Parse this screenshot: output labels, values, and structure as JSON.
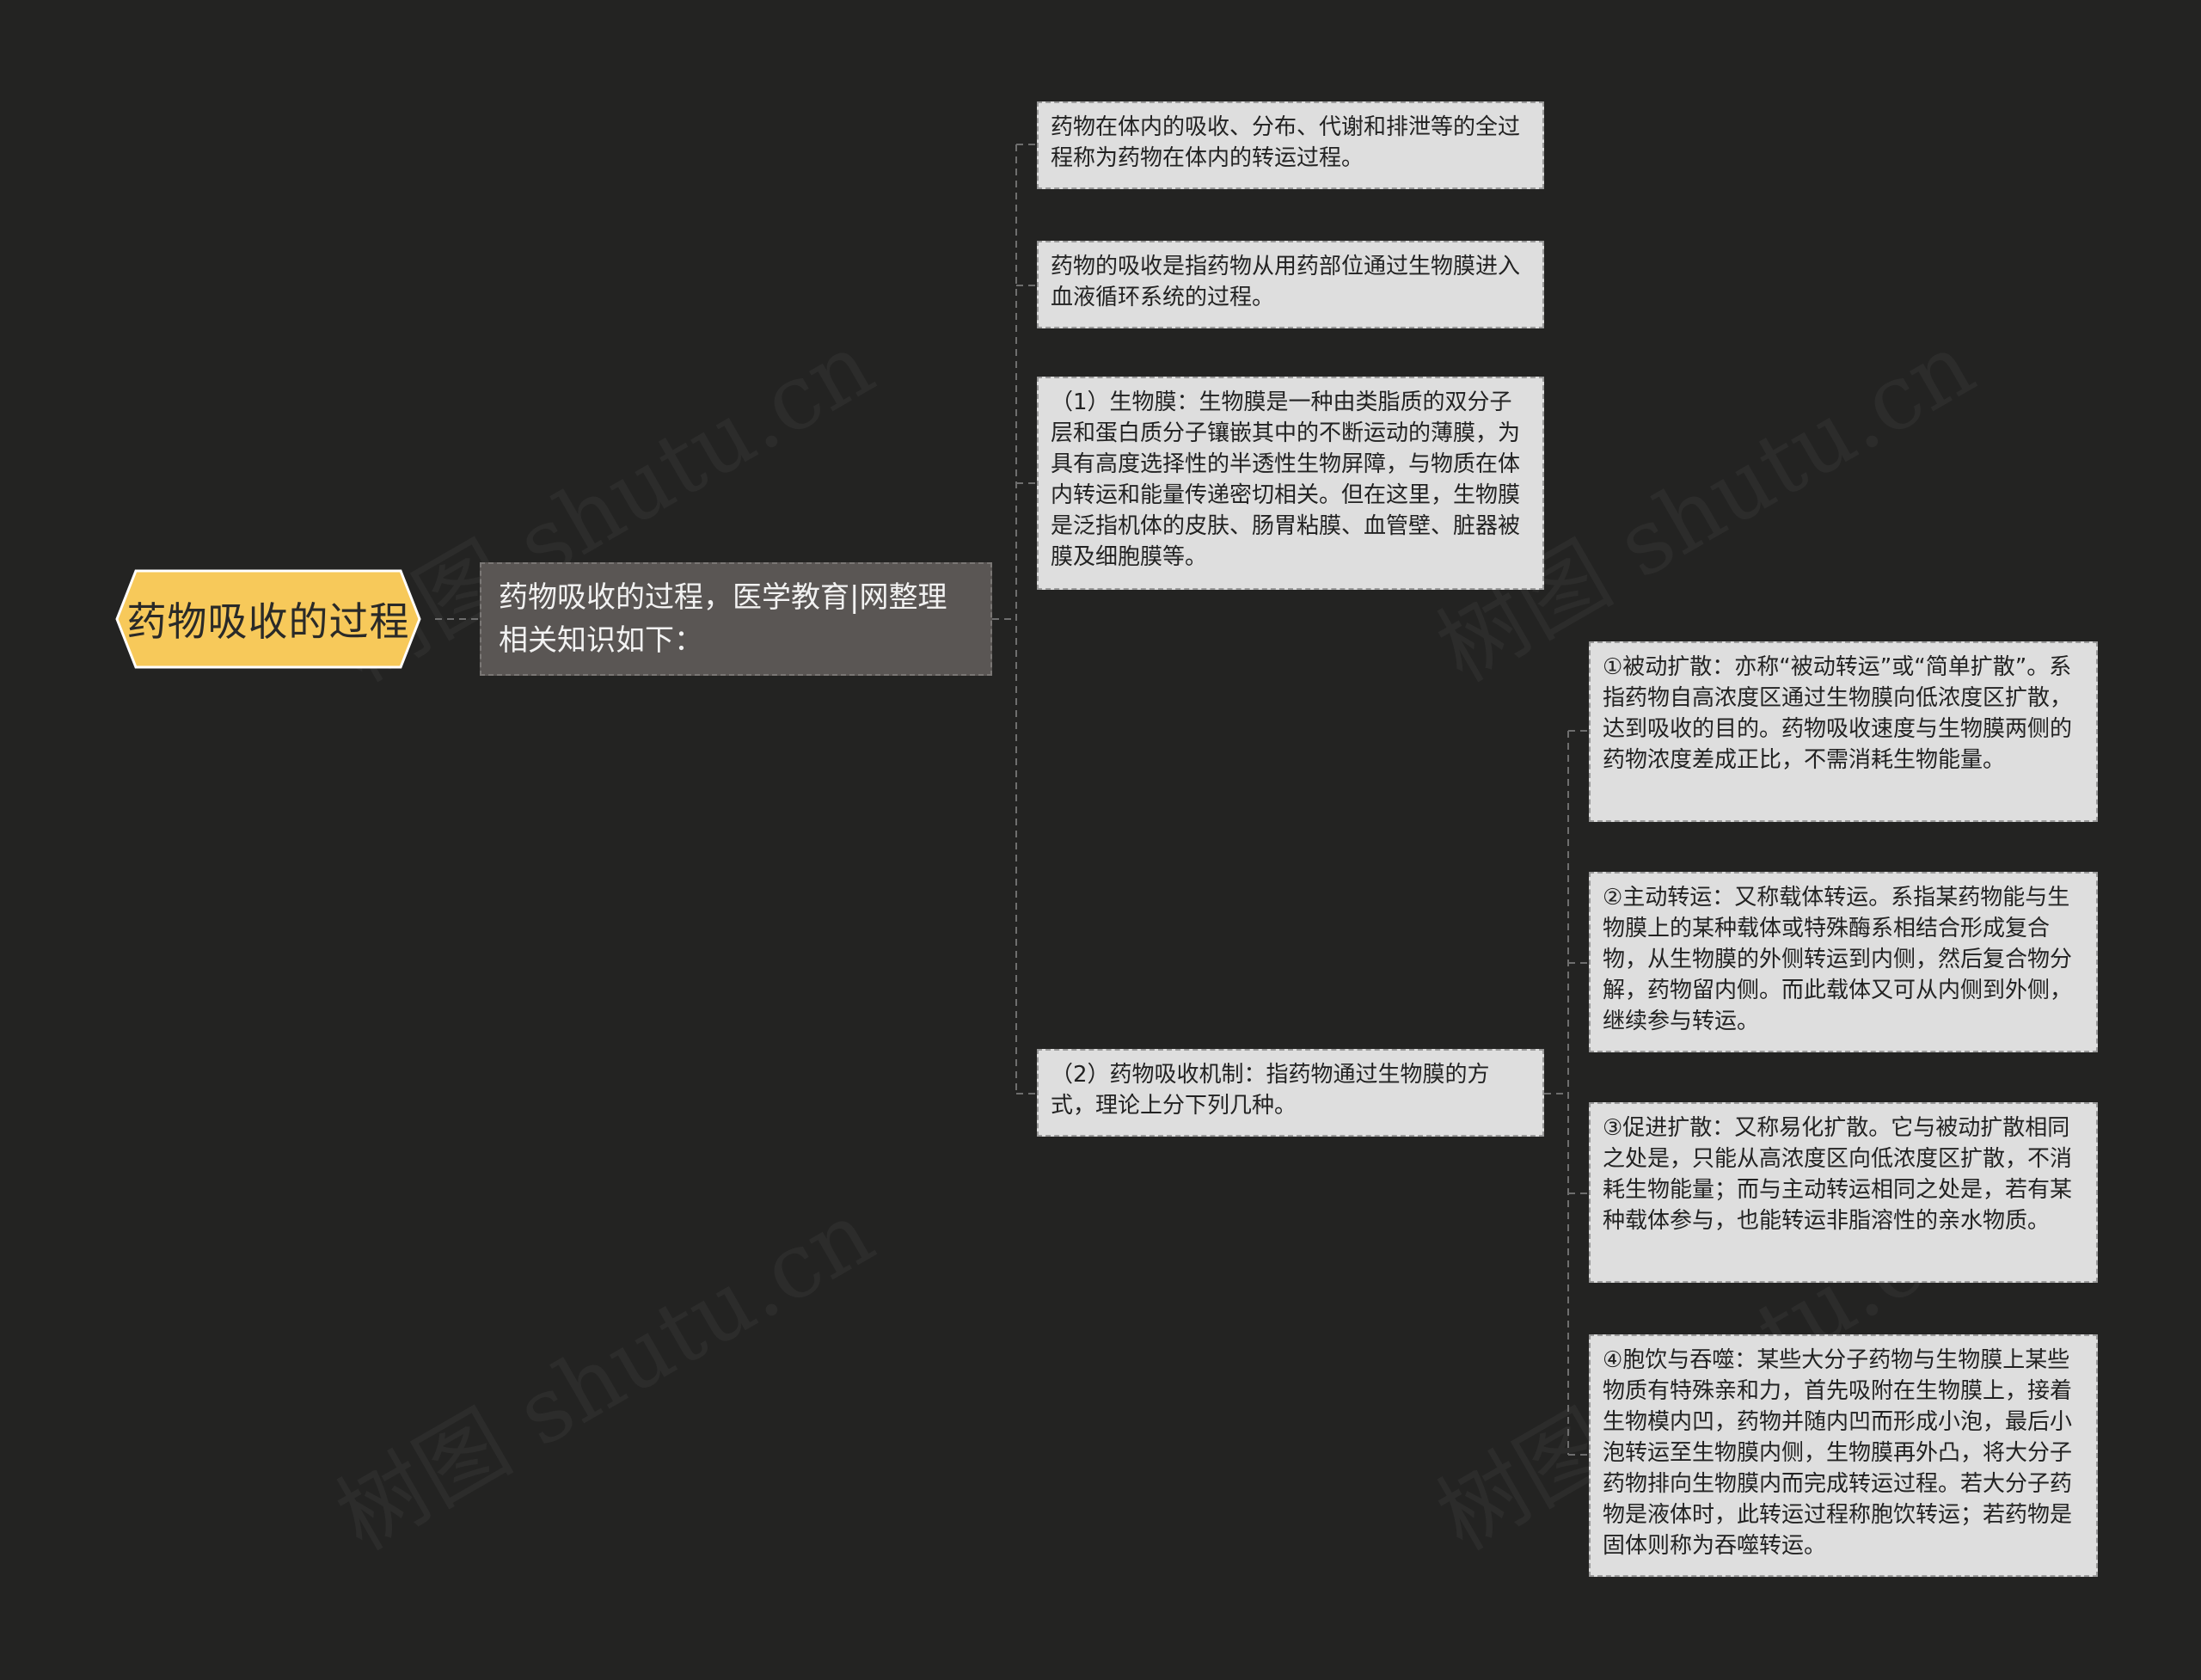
{
  "root": {
    "label": "药物吸收的过程"
  },
  "branch": {
    "label": "药物吸收的过程，医学教育|网整理相关知识如下："
  },
  "children": [
    {
      "text": "药物在体内的吸收、分布、代谢和排泄等的全过程称为药物在体内的转运过程。"
    },
    {
      "text": "药物的吸收是指药物从用药部位通过生物膜进入血液循环系统的过程。"
    },
    {
      "text": "（1）生物膜：生物膜是一种由类脂质的双分子层和蛋白质分子镶嵌其中的不断运动的薄膜，为具有高度选择性的半透性生物屏障，与物质在体内转运和能量传递密切相关。但在这里，生物膜是泛指机体的皮肤、肠胃粘膜、血管壁、脏器被膜及细胞膜等。"
    },
    {
      "text": "（2）药物吸收机制：指药物通过生物膜的方式，理论上分下列几种。"
    }
  ],
  "mechanisms": [
    {
      "text": "①被动扩散：亦称“被动转运”或“简单扩散”。系指药物自高浓度区通过生物膜向低浓度区扩散，达到吸收的目的。药物吸收速度与生物膜两侧的药物浓度差成正比，不需消耗生物能量。"
    },
    {
      "text": "②主动转运：又称载体转运。系指某药物能与生物膜上的某种载体或特殊酶系相结合形成复合物，从生物膜的外侧转运到内侧，然后复合物分解，药物留内侧。而此载体又可从内侧到外侧，继续参与转运。"
    },
    {
      "text": "③促进扩散：又称易化扩散。它与被动扩散相同之处是，只能从高浓度区向低浓度区扩散，不消耗生物能量；而与主动转运相同之处是，若有某种载体参与，也能转运非脂溶性的亲水物质。"
    },
    {
      "text": "④胞饮与吞噬：某些大分子药物与生物膜上某些物质有特殊亲和力，首先吸附在生物膜上，接着生物模内凹，药物并随内凹而形成小泡，最后小泡转运至生物膜内侧，生物膜再外凸，将大分子药物排向生物膜内而完成转运过程。若大分子药物是液体时，此转运过程称胞饮转运；若药物是固体则称为吞噬转运。"
    }
  ],
  "watermark": {
    "text": "树图 shutu.cn"
  },
  "colors": {
    "background": "#232322",
    "root_fill": "#f7c95a",
    "root_border": "#ffffff",
    "branch_fill": "#5a5654",
    "node_fill": "#dedede",
    "connector": "#6e6e6e"
  }
}
